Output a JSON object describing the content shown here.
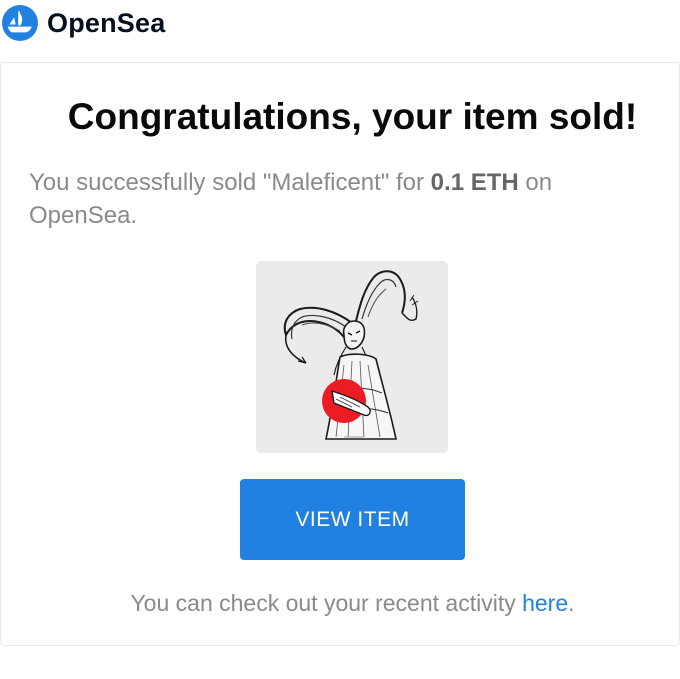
{
  "brand": {
    "name": "OpenSea",
    "accent_color": "#2081E2",
    "logo_icon": "opensea-logo-icon"
  },
  "email": {
    "title": "Congratulations, your item sold!",
    "message": {
      "prefix": "You successfully sold \"Maleficent\" for ",
      "price": "0.1 ETH",
      "suffix": " on OpenSea."
    },
    "item": {
      "image_alt": "Maleficent",
      "image_icon": "maleficent-artwork-image"
    },
    "button_label": "VIEW ITEM",
    "footer": {
      "text": "You can check out your recent activity ",
      "link_text": "here",
      "end": "."
    }
  }
}
